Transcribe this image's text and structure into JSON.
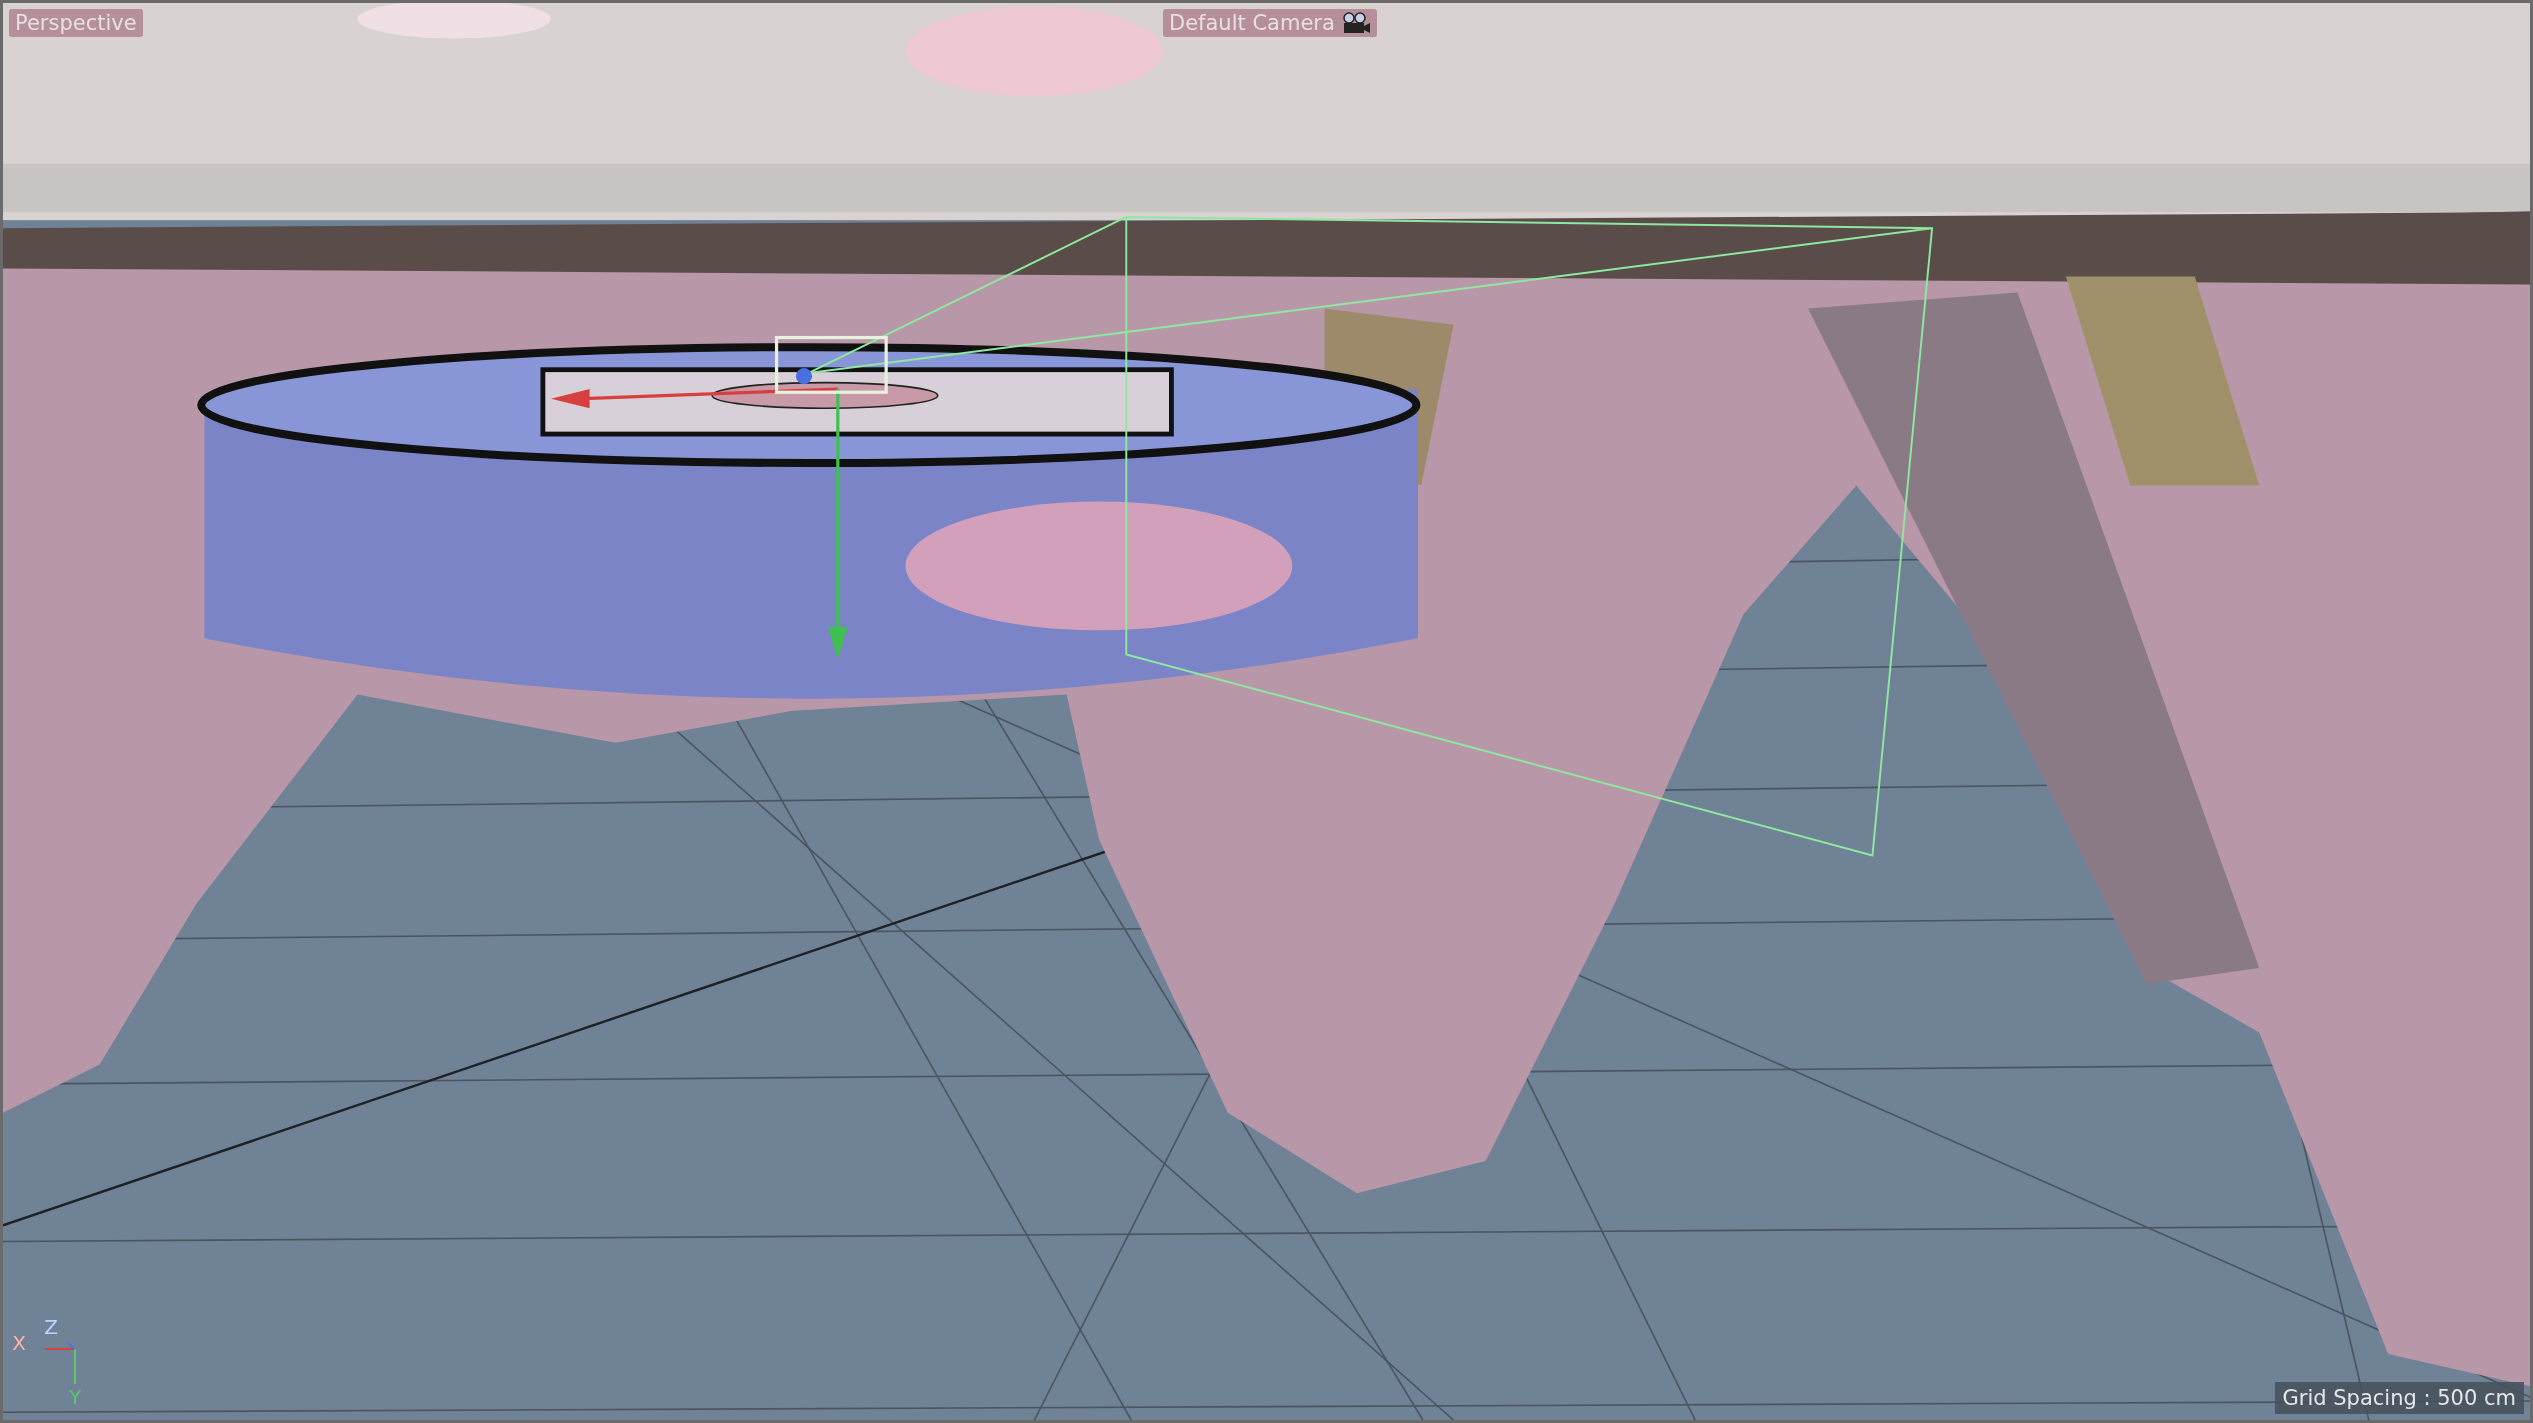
{
  "viewport": {
    "view_label": "Perspective",
    "camera_label": "Default Camera",
    "grid_spacing": "Grid Spacing : 500 cm",
    "axis_gizmo": [
      {
        "kind": "x",
        "label": "X"
      },
      {
        "kind": "z",
        "label": "Z"
      },
      {
        "kind": "y",
        "label": "Y"
      }
    ]
  }
}
